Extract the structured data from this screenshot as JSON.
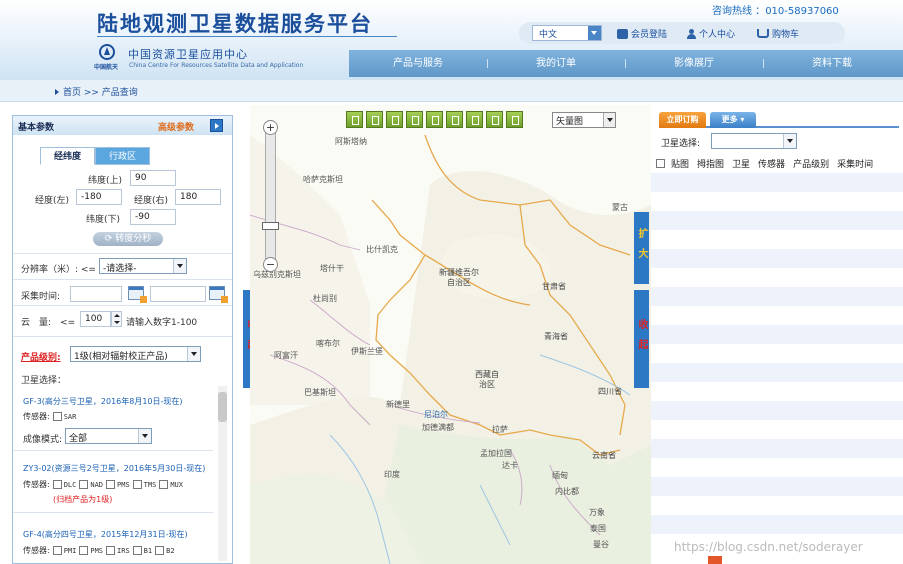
{
  "header": {
    "site_title": "陆地观测卫星数据服务平台",
    "org_cn": "中国资源卫星应用中心",
    "org_en": "China Centre For Resources Satellite Data and Application",
    "logo_sub": "中国航天",
    "hotline_label": "咨询热线 ：",
    "hotline_number": "010-58937060",
    "language": "中文",
    "login": "会员登陆",
    "user_center": "个人中心",
    "cart": "购物车"
  },
  "nav": {
    "items": [
      "产品与服务",
      "我的订单",
      "影像展厅",
      "资料下载"
    ]
  },
  "breadcrumb": "首页 >> 产品查询",
  "left": {
    "title": "基本参数",
    "advanced": "高级参数",
    "tabs": [
      "经纬度",
      "行政区"
    ],
    "lat_top_label": "纬度(上)",
    "lat_top_value": "90",
    "lon_left_label": "经度(左)",
    "lon_left_value": "-180",
    "lon_right_label": "经度(右)",
    "lon_right_value": "180",
    "lat_bottom_label": "纬度(下)",
    "lat_bottom_value": "-90",
    "convert_button": "转度分秒",
    "resolution_label": "分辨率（米）: <=",
    "resolution_value": "-请选择-",
    "time_label": "采集时间:",
    "cloud_label": "云　量:　<=",
    "cloud_value": "100",
    "cloud_hint": "请输入数字1-100",
    "level_label": "产品级别:",
    "level_value": "1级(相对辐射校正产品)",
    "sat_select_label": "卫星选择：",
    "sensor_label": "传感器:",
    "imaging_mode_label": "成像模式:",
    "imaging_mode_value": "全部",
    "satellites": [
      {
        "title": "GF-3(高分三号卫星，2016年8月10日-现在)",
        "sensors": [
          "SAR"
        ]
      },
      {
        "title": "ZY3-02(资源三号2号卫星，2016年5月30日-现在)",
        "sensors": [
          "DLC",
          "NAD",
          "PMS",
          "TMS",
          "MUX"
        ],
        "note": "(归档产品为1级)"
      },
      {
        "title": "GF-4(高分四号卫星，2015年12月31日-现在)",
        "sensors": [
          "PMI",
          "PMS",
          "IRS",
          "B1",
          "B2"
        ]
      }
    ]
  },
  "side_tabs": {
    "left_collapse": "收起",
    "right_expand": "扩大",
    "right_collapse": "收起"
  },
  "map": {
    "layer": "矢量图",
    "places": [
      {
        "name": "阿斯塔纳",
        "kind": "city"
      },
      {
        "name": "哈萨克斯坦",
        "kind": "country"
      },
      {
        "name": "比什凯克",
        "kind": "city"
      },
      {
        "name": "塔什干",
        "kind": "city"
      },
      {
        "name": "乌兹别克斯坦",
        "kind": "country"
      },
      {
        "name": "杜尚别",
        "kind": "city"
      },
      {
        "name": "新疆维吾尔自治区",
        "kind": "province"
      },
      {
        "name": "甘肃省",
        "kind": "province"
      },
      {
        "name": "青海省",
        "kind": "province"
      },
      {
        "name": "喀布尔",
        "kind": "city"
      },
      {
        "name": "伊斯兰堡",
        "kind": "city"
      },
      {
        "name": "阿富汗",
        "kind": "country"
      },
      {
        "name": "巴基斯坦",
        "kind": "country"
      },
      {
        "name": "西藏自治区",
        "kind": "province"
      },
      {
        "name": "新德里",
        "kind": "city"
      },
      {
        "name": "尼泊尔",
        "kind": "country"
      },
      {
        "name": "加德满都",
        "kind": "city"
      },
      {
        "name": "拉萨",
        "kind": "city"
      },
      {
        "name": "孟加拉国",
        "kind": "country"
      },
      {
        "name": "达卡",
        "kind": "city"
      },
      {
        "name": "印度",
        "kind": "country"
      },
      {
        "name": "四川省",
        "kind": "province"
      },
      {
        "name": "云南省",
        "kind": "province"
      },
      {
        "name": "缅甸",
        "kind": "country"
      },
      {
        "name": "内比都",
        "kind": "city"
      },
      {
        "name": "万象",
        "kind": "city"
      },
      {
        "name": "泰国",
        "kind": "country"
      },
      {
        "name": "曼谷",
        "kind": "city"
      },
      {
        "name": "蒙古",
        "kind": "country"
      }
    ]
  },
  "right": {
    "order_tab": "立即订购",
    "more_tab": "更多",
    "sat_select_label": "卫星选择:",
    "columns": [
      "贴图",
      "拇指图",
      "卫星",
      "传感器",
      "产品级别",
      "采集时间"
    ]
  },
  "watermark": "https://blog.csdn.net/soderayer"
}
